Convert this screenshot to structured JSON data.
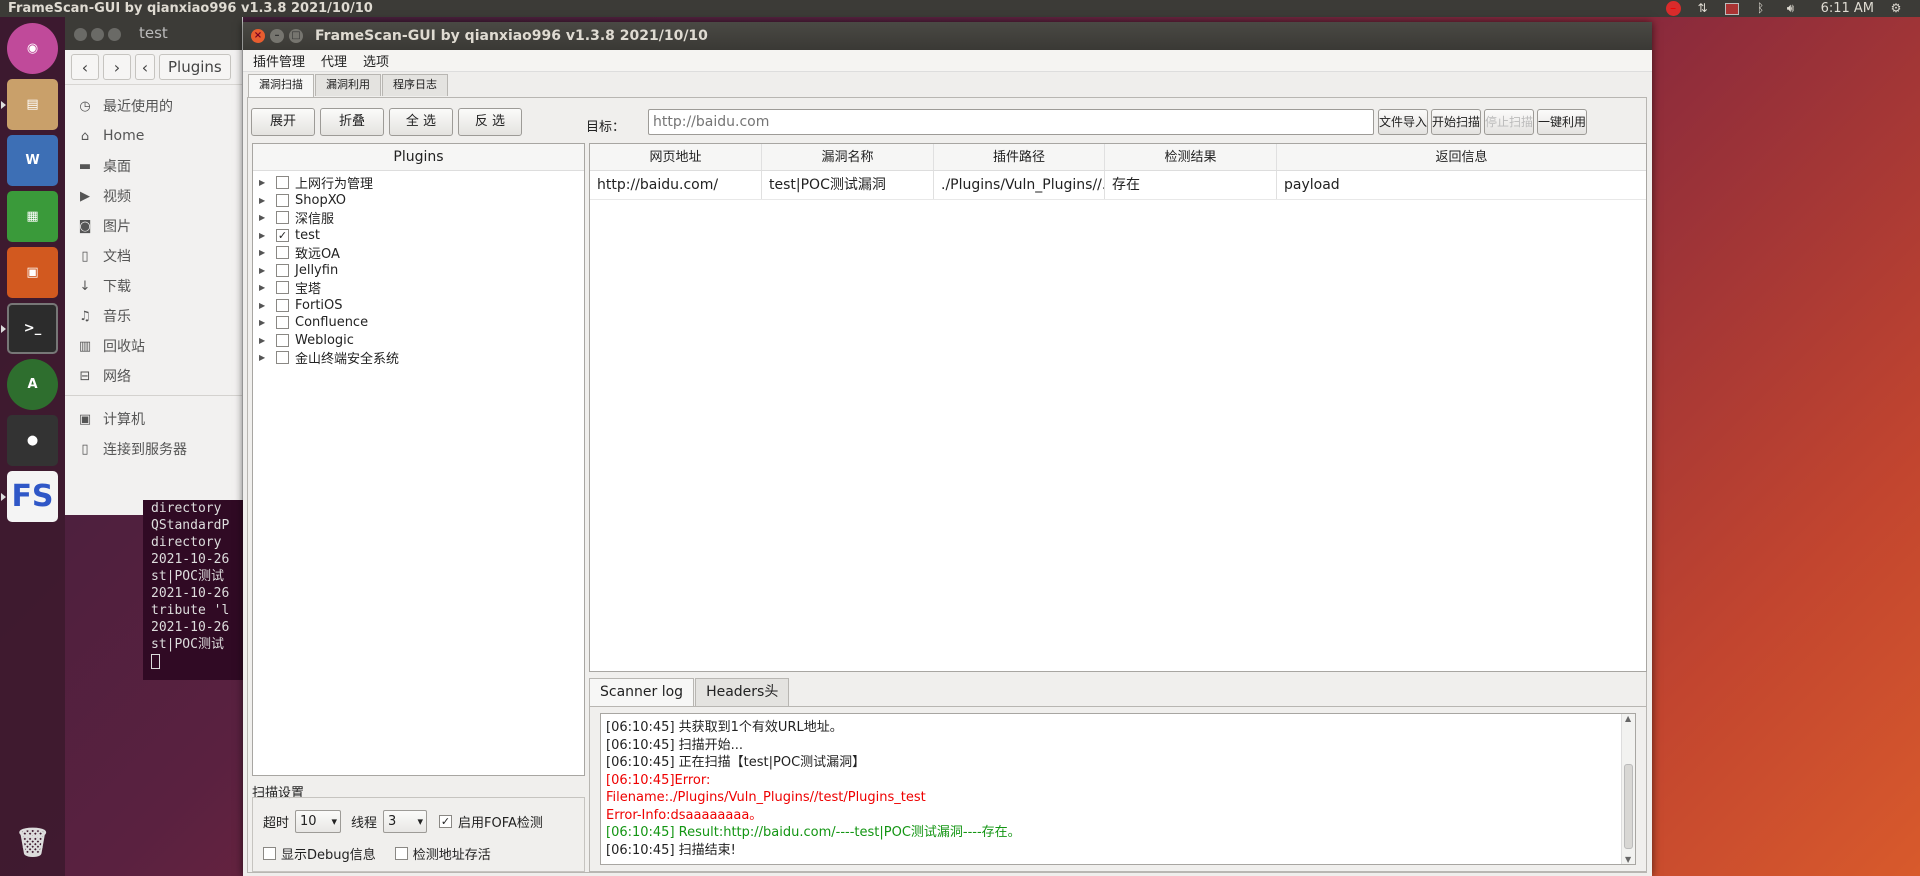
{
  "top_panel": {
    "title": "FrameScan-GUI  by qianxiao996 v1.3.8 2021/10/10",
    "clock": "6:11 AM"
  },
  "file_manager": {
    "title": "test",
    "breadcrumb": "Plugins",
    "items": [
      {
        "icon": "clock-icon",
        "label": "最近使用的"
      },
      {
        "icon": "home-icon",
        "label": "Home"
      },
      {
        "icon": "folder-icon",
        "label": "桌面"
      },
      {
        "icon": "video-icon",
        "label": "视频"
      },
      {
        "icon": "camera-icon",
        "label": "图片"
      },
      {
        "icon": "document-icon",
        "label": "文档"
      },
      {
        "icon": "download-icon",
        "label": "下载"
      },
      {
        "icon": "music-icon",
        "label": "音乐"
      },
      {
        "icon": "trash-icon",
        "label": "回收站"
      },
      {
        "icon": "network-icon",
        "label": "网络"
      }
    ],
    "extra_items": [
      {
        "icon": "computer-icon",
        "label": "计算机"
      },
      {
        "icon": "server-icon",
        "label": "连接到服务器"
      }
    ]
  },
  "terminal": {
    "lines": [
      "directory",
      "QStandardP",
      "directory",
      "2021-10-26",
      "st|POC测试",
      "2021-10-26",
      "tribute 'l",
      "2021-10-26",
      "st|POC测试"
    ]
  },
  "window": {
    "title": "FrameScan-GUI  by qianxiao996 v1.3.8 2021/10/10",
    "menu": [
      "插件管理",
      "代理",
      "选项"
    ],
    "tabs": [
      "漏洞扫描",
      "漏洞利用",
      "程序日志"
    ],
    "buttons": {
      "expand": "展开",
      "collapse": "折叠",
      "select_all": "全 选",
      "invert": "反 选",
      "file_import": "文件导入",
      "start_scan": "开始扫描",
      "stop_scan": "停止扫描",
      "one_click": "一键利用"
    },
    "target": {
      "label": "目标：",
      "placeholder": "http://baidu.com"
    },
    "plugins": {
      "header": "Plugins",
      "items": [
        {
          "label": "上网行为管理",
          "checked": false
        },
        {
          "label": "ShopXO",
          "checked": false
        },
        {
          "label": "深信服",
          "checked": false
        },
        {
          "label": "test",
          "checked": true
        },
        {
          "label": "致远OA",
          "checked": false
        },
        {
          "label": "Jellyfin",
          "checked": false
        },
        {
          "label": "宝塔",
          "checked": false
        },
        {
          "label": "FortiOS",
          "checked": false
        },
        {
          "label": "Confluence",
          "checked": false
        },
        {
          "label": "Weblogic",
          "checked": false
        },
        {
          "label": "金山终端安全系统",
          "checked": false
        }
      ]
    },
    "scan_settings": {
      "title": "扫描设置",
      "timeout_label": "超时",
      "timeout_value": "10",
      "threads_label": "线程",
      "threads_value": "3",
      "fofa_label": "启用FOFA检测",
      "fofa_checked": true,
      "debug_label": "显示Debug信息",
      "debug_checked": false,
      "save_label": "检测地址存活",
      "save_checked": false
    },
    "results": {
      "columns": [
        "网页地址",
        "漏洞名称",
        "插件路径",
        "检测结果",
        "返回信息"
      ],
      "rows": [
        [
          "http://baidu.com/",
          "test|POC测试漏洞",
          "./Plugins/Vuln_Plugins//...",
          "存在",
          "payload"
        ]
      ]
    },
    "log_tabs": [
      "Scanner log",
      "Headers头"
    ],
    "log": [
      {
        "text": "[06:10:45] 共获取到1个有效URL地址。",
        "color": "normal"
      },
      {
        "text": "[06:10:45] 扫描开始...",
        "color": "normal"
      },
      {
        "text": "[06:10:45] 正在扫描【test|POC测试漏洞】",
        "color": "normal"
      },
      {
        "text": "[06:10:45]Error:",
        "color": "red"
      },
      {
        "text": "Filename:./Plugins/Vuln_Plugins//test/Plugins_test",
        "color": "red"
      },
      {
        "text": "Error-Info:dsaaaaaaaa。",
        "color": "red"
      },
      {
        "text": "[06:10:45] Result:http://baidu.com/----test|POC测试漏洞----存在。",
        "color": "green"
      },
      {
        "text": "[06:10:45] 扫描结束!",
        "color": "normal"
      }
    ]
  },
  "colors": {
    "log_error": "#ee0000",
    "log_success": "#139513"
  }
}
